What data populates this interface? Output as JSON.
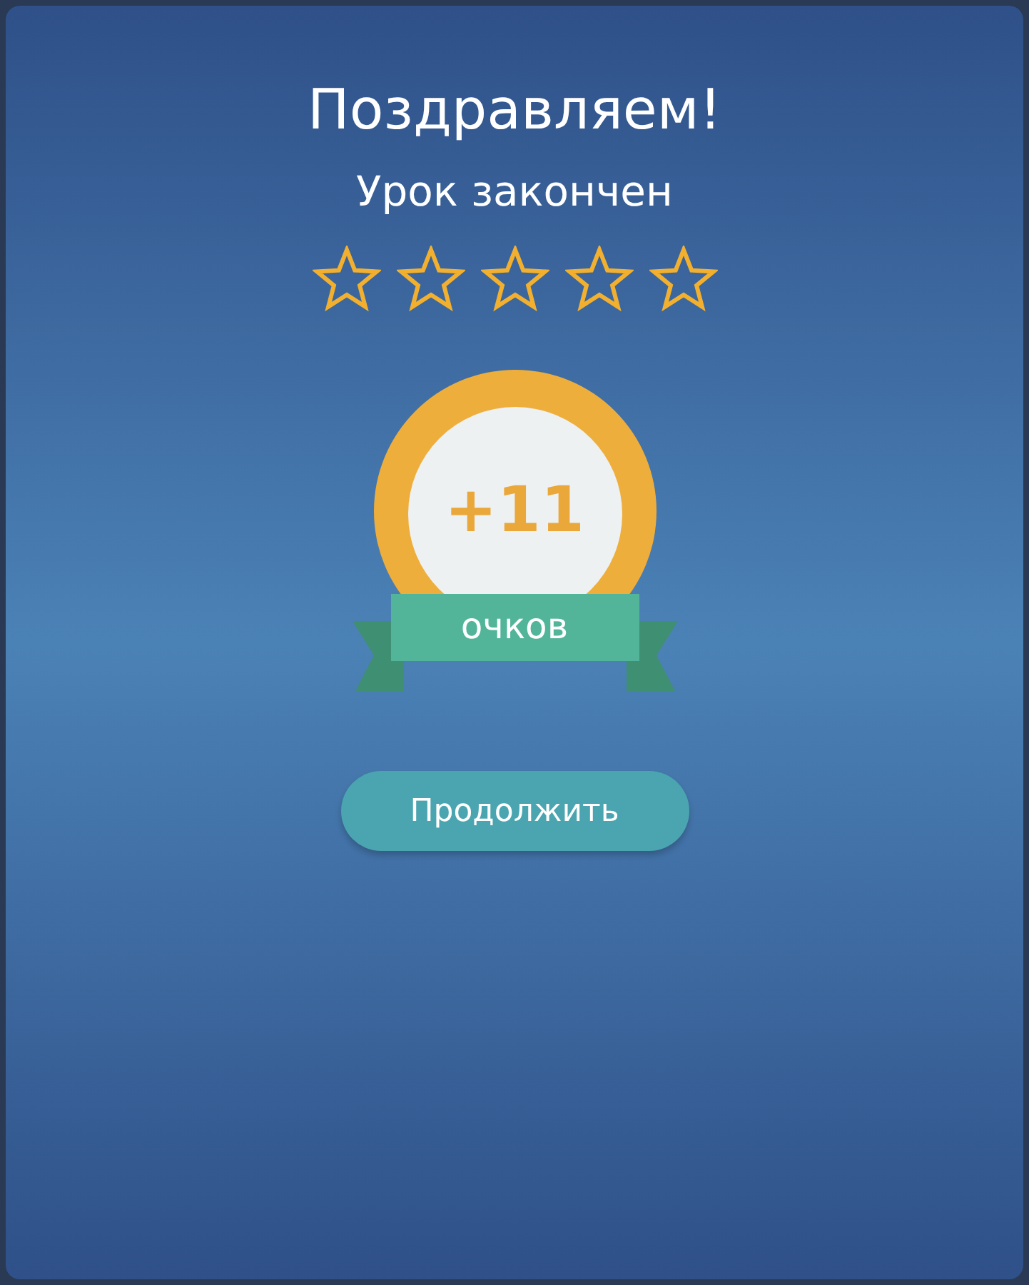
{
  "dialog": {
    "title": "Поздравляем!",
    "subtitle": "Урок закончен",
    "rating": {
      "stars": 0
    },
    "reward": {
      "value": "+11",
      "label": "очков"
    },
    "button": "Продолжить"
  }
}
